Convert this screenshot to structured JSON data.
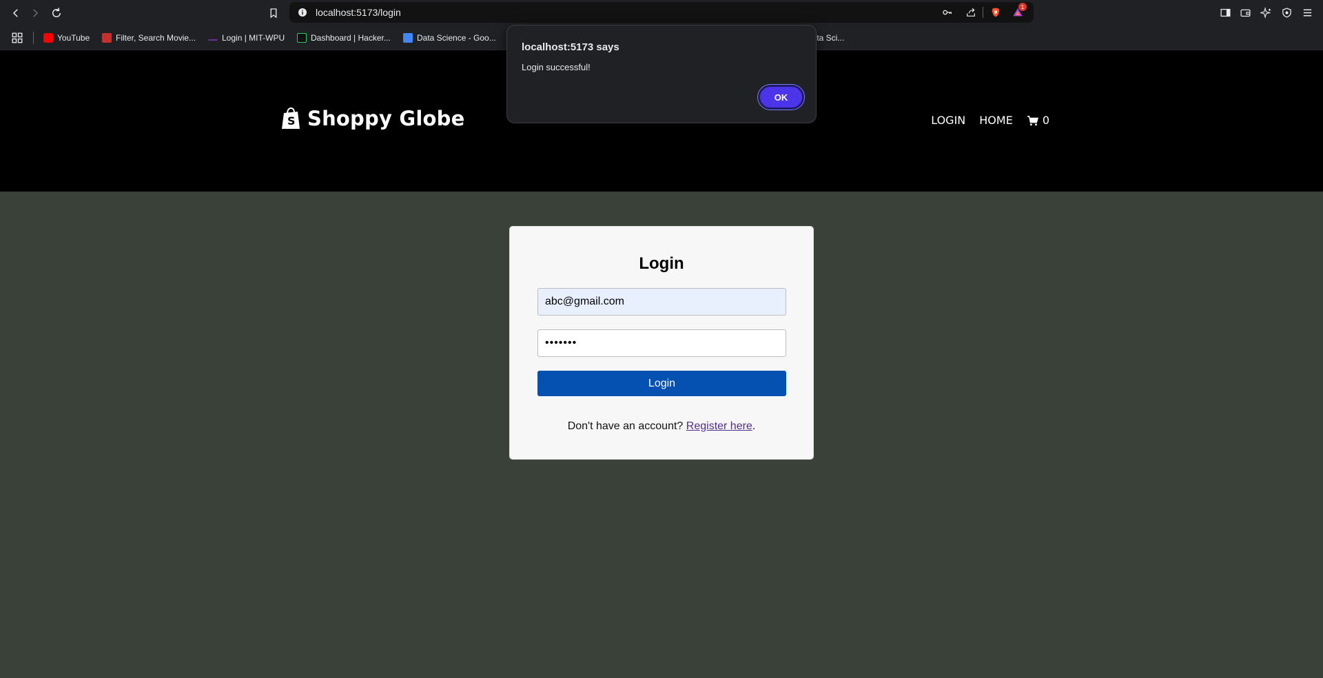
{
  "browser": {
    "url": "localhost:5173/login",
    "bookmarks": [
      {
        "label": "YouTube",
        "color": "#ff0000"
      },
      {
        "label": "Filter, Search Movie...",
        "color": "#c4302b"
      },
      {
        "label": "Login | MIT-WPU",
        "color": "#6b2fa0"
      },
      {
        "label": "Dashboard | Hacker...",
        "color": "#1a1a1a"
      },
      {
        "label": "Data Science - Goo...",
        "color": "#4285f4"
      },
      {
        "label": "Data Sci...",
        "color": "#555555"
      }
    ],
    "notification_count": "1"
  },
  "dialog": {
    "title": "localhost:5173 says",
    "message": "Login successful!",
    "ok_label": "OK"
  },
  "site": {
    "brand": "Shoppy Globe",
    "nav": {
      "login": "LOGIN",
      "home": "HOME",
      "cart_count": "0"
    }
  },
  "login_form": {
    "title": "Login",
    "email_value": "abc@gmail.com",
    "password_value": "•••••••",
    "button_label": "Login",
    "register_prompt": "Don't have an account?",
    "register_link": "Register here",
    "register_suffix": "."
  },
  "colors": {
    "page_bg": "#3a4139",
    "header_bg": "#000000",
    "button_bg": "#0451b1",
    "dialog_ok_bg": "#4b34ea"
  }
}
